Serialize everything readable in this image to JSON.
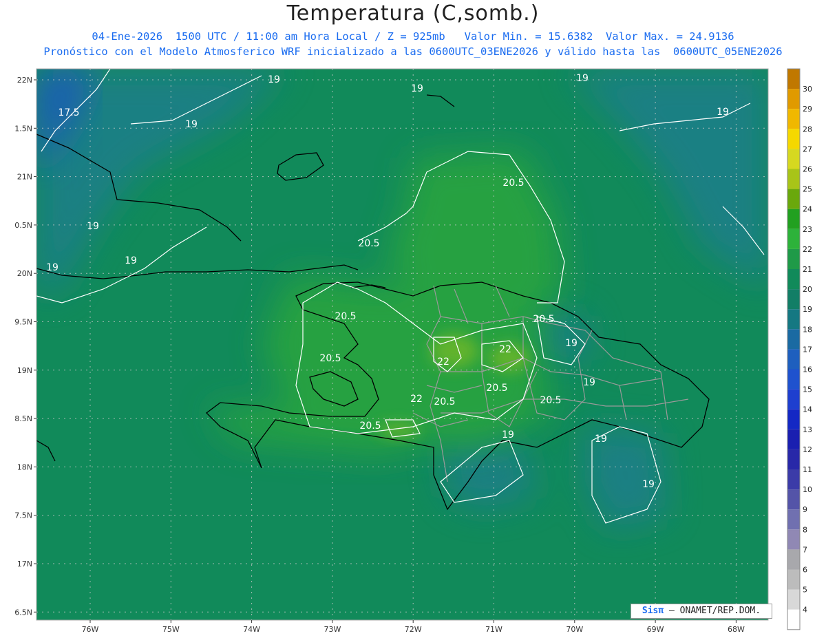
{
  "header": {
    "title": "Temperatura (C,somb.)",
    "subtitle_line1": "04-Ene-2026  1500 UTC / 11:00 am Hora Local / Z = 925mb   Valor Min. = 15.6382  Valor Max. = 24.9136",
    "subtitle_line2": "Pronóstico con el Modelo Atmosferico WRF inicializado a las 0600UTC_03ENE2026 y válido hasta las  0600UTC_05ENE2026"
  },
  "map": {
    "lat_labels": [
      "22N",
      "1.5N",
      "21N",
      "0.5N",
      "20N",
      "9.5N",
      "19N",
      "8.5N",
      "18N",
      "7.5N",
      "17N",
      "6.5N"
    ],
    "lon_labels": [
      "76W",
      "75W",
      "74W",
      "73W",
      "72W",
      "71W",
      "70W",
      "69W",
      "68W"
    ],
    "contour_labels": [
      "19",
      "19",
      "19",
      "19",
      "17.5",
      "19",
      "19",
      "19",
      "19",
      "20.5",
      "20.5",
      "20.5",
      "20.5",
      "20.5",
      "22",
      "22",
      "22",
      "20.5",
      "20.5",
      "20.5",
      "20.5",
      "19",
      "19",
      "19",
      "19",
      "19"
    ],
    "field_colors": {
      "background": "#118a5a",
      "cool": "#1a7f88",
      "cold": "#1f5fb2",
      "warm": "#2aa63e",
      "hot": "#67b52c"
    }
  },
  "colorbar": {
    "labels": [
      "30",
      "29",
      "28",
      "27",
      "26",
      "25",
      "24",
      "23",
      "22",
      "21",
      "20",
      "19",
      "18",
      "17",
      "16",
      "15",
      "14",
      "13",
      "12",
      "11",
      "10",
      "9",
      "8",
      "7",
      "6",
      "5",
      "4"
    ],
    "colors": [
      "#c07800",
      "#e09a00",
      "#f0b800",
      "#f5d800",
      "#d6d820",
      "#a8c418",
      "#6aa80c",
      "#22a020",
      "#2db23a",
      "#1f9a48",
      "#118a5a",
      "#127e66",
      "#157882",
      "#1a6aa2",
      "#1e5fbe",
      "#1f52ce",
      "#1e3fcf",
      "#1428c4",
      "#1a1fb0",
      "#2828a8",
      "#3b3ba8",
      "#5454a8",
      "#7070b0",
      "#9088b4",
      "#a8a8ac",
      "#bcbcbc",
      "#d8d8d8",
      "#ffffff"
    ]
  },
  "credit": {
    "logo": "Sisπ",
    "text": "– ONAMET/REP.DOM."
  }
}
